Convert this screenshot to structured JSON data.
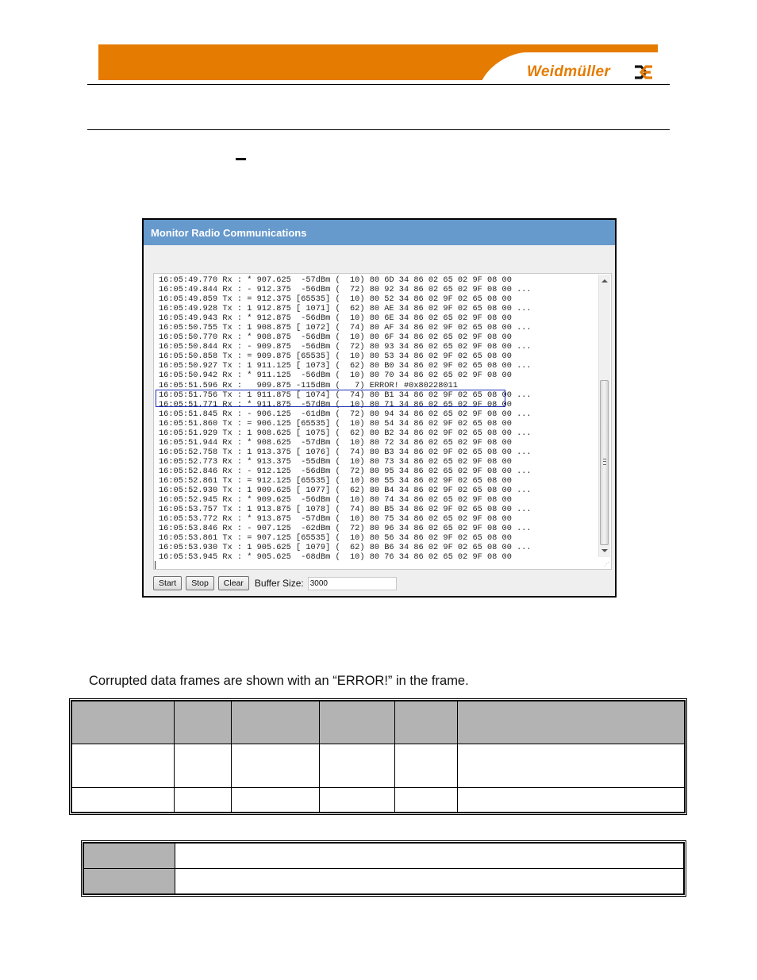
{
  "header": {
    "brand": "Weidmüller",
    "brand_color": "#e57b00",
    "logo_icon": "weidmuller-cross-icon"
  },
  "section_dash": "–",
  "monitor": {
    "title": "Monitor Radio Communications",
    "title_bar_color": "#6699cc",
    "log_lines": [
      "16:05:49.770 Rx : * 907.625  -57dBm (  10) 80 6D 34 86 02 65 02 9F 08 00",
      "16:05:49.844 Rx : - 912.375  -56dBm (  72) 80 92 34 86 02 65 02 9F 08 00 ...",
      "16:05:49.859 Tx : = 912.375 [65535] (  10) 80 52 34 86 02 9F 02 65 08 00",
      "16:05:49.928 Tx : 1 912.875 [ 1071] (  62) 80 AE 34 86 02 9F 02 65 08 00 ...",
      "16:05:49.943 Rx : * 912.875  -56dBm (  10) 80 6E 34 86 02 65 02 9F 08 00",
      "16:05:50.755 Tx : 1 908.875 [ 1072] (  74) 80 AF 34 86 02 9F 02 65 08 00 ...",
      "16:05:50.770 Rx : * 908.875  -56dBm (  10) 80 6F 34 86 02 65 02 9F 08 00",
      "16:05:50.844 Rx : - 909.875  -56dBm (  72) 80 93 34 86 02 65 02 9F 08 00 ...",
      "16:05:50.858 Tx : = 909.875 [65535] (  10) 80 53 34 86 02 9F 02 65 08 00",
      "16:05:50.927 Tx : 1 911.125 [ 1073] (  62) 80 B0 34 86 02 9F 02 65 08 00 ...",
      "16:05:50.942 Rx : * 911.125  -56dBm (  10) 80 70 34 86 02 65 02 9F 08 00",
      "16:05:51.596 Rx :   909.875 -115dBm (   7) ERROR! #0x80228011",
      "16:05:51.756 Tx : 1 911.875 [ 1074] (  74) 80 B1 34 86 02 9F 02 65 08 00 ...",
      "16:05:51.771 Rx : * 911.875  -57dBm (  10) 80 71 34 86 02 65 02 9F 08 00",
      "16:05:51.845 Rx : - 906.125  -61dBm (  72) 80 94 34 86 02 65 02 9F 08 00 ...",
      "16:05:51.860 Tx : = 906.125 [65535] (  10) 80 54 34 86 02 9F 02 65 08 00",
      "16:05:51.929 Tx : 1 908.625 [ 1075] (  62) 80 B2 34 86 02 9F 02 65 08 00 ...",
      "16:05:51.944 Rx : * 908.625  -57dBm (  10) 80 72 34 86 02 65 02 9F 08 00",
      "16:05:52.758 Tx : 1 913.375 [ 1076] (  74) 80 B3 34 86 02 9F 02 65 08 00 ...",
      "16:05:52.773 Rx : * 913.375  -55dBm (  10) 80 73 34 86 02 65 02 9F 08 00",
      "16:05:52.846 Rx : - 912.125  -56dBm (  72) 80 95 34 86 02 65 02 9F 08 00 ...",
      "16:05:52.861 Tx : = 912.125 [65535] (  10) 80 55 34 86 02 9F 02 65 08 00",
      "16:05:52.930 Tx : 1 909.625 [ 1077] (  62) 80 B4 34 86 02 9F 02 65 08 00 ...",
      "16:05:52.945 Rx : * 909.625  -56dBm (  10) 80 74 34 86 02 65 02 9F 08 00",
      "16:05:53.757 Tx : 1 913.875 [ 1078] (  74) 80 B5 34 86 02 9F 02 65 08 00 ...",
      "16:05:53.772 Rx : * 913.875  -57dBm (  10) 80 75 34 86 02 65 02 9F 08 00",
      "16:05:53.846 Rx : - 907.125  -62dBm (  72) 80 96 34 86 02 65 02 9F 08 00 ...",
      "16:05:53.861 Tx : = 907.125 [65535] (  10) 80 56 34 86 02 9F 02 65 08 00",
      "16:05:53.930 Tx : 1 905.625 [ 1079] (  62) 80 B6 34 86 02 9F 02 65 08 00 ...",
      "16:05:53.945 Rx : * 905.625  -68dBm (  10) 80 76 34 86 02 65 02 9F 08 00"
    ],
    "highlight_color": "#1c2fb5",
    "buttons": {
      "start": "Start",
      "stop": "Stop",
      "clear": "Clear"
    },
    "buffer_label": "Buffer Size:",
    "buffer_value": "3000"
  },
  "caption": "Corrupted data frames are shown with an “ERROR!” in the frame.",
  "table1": {
    "header_color": "#b3b3b3",
    "rows": [
      [
        "",
        "",
        "",
        "",
        "",
        ""
      ],
      [
        "",
        "",
        "",
        "",
        "",
        ""
      ],
      [
        "",
        "",
        "",
        "",
        "",
        ""
      ]
    ]
  },
  "table2": {
    "rows": [
      [
        "",
        ""
      ],
      [
        "",
        ""
      ]
    ]
  }
}
